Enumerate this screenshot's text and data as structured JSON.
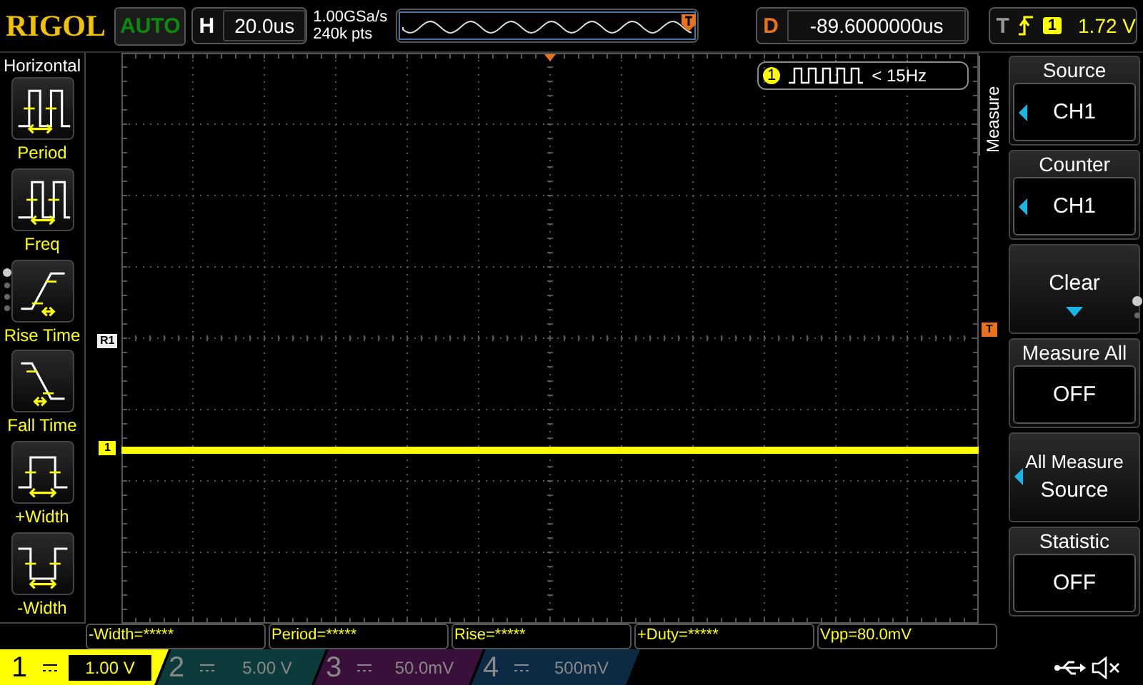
{
  "header": {
    "logo": "RIGOL",
    "run_status": "AUTO",
    "horizontal": {
      "label": "H",
      "value": "20.0us"
    },
    "sample_rate": "1.00GSa/s",
    "memory_depth": "240k pts",
    "delay": {
      "label": "D",
      "value": "-89.6000000us"
    },
    "trigger": {
      "label": "T",
      "channel": "1",
      "level": "1.72 V"
    }
  },
  "left_menu": {
    "title": "Horizontal",
    "items": [
      {
        "kind": "period",
        "label": "Period"
      },
      {
        "kind": "freq",
        "label": "Freq"
      },
      {
        "kind": "rise",
        "label": "Rise Time"
      },
      {
        "kind": "fall",
        "label": "Fall Time"
      },
      {
        "kind": "pwidth",
        "label": "+Width"
      },
      {
        "kind": "nwidth",
        "label": "-Width"
      }
    ]
  },
  "display": {
    "reference_marker": "R1",
    "channel_marker": "1",
    "trigger_marker": "T",
    "counter": {
      "channel": "1",
      "reading": "< 15Hz"
    }
  },
  "right_menu": {
    "title": "Measure",
    "items": [
      {
        "kind": "option",
        "label": "Source",
        "value": "CH1"
      },
      {
        "kind": "option",
        "label": "Counter",
        "value": "CH1"
      },
      {
        "kind": "action",
        "label": "Clear"
      },
      {
        "kind": "toggle",
        "label": "Measure All",
        "value": "OFF"
      },
      {
        "kind": "submenu",
        "label": "All Measure",
        "value": "Source"
      },
      {
        "kind": "toggle",
        "label": "Statistic",
        "value": "OFF"
      }
    ]
  },
  "measurements": [
    "-Width=*****",
    "Period=*****",
    "Rise=*****",
    "+Duty=*****",
    "Vpp=80.0mV"
  ],
  "channels": [
    {
      "number": "1",
      "scale": "1.00 V",
      "selected": true,
      "color": "#ffff00"
    },
    {
      "number": "2",
      "scale": "5.00 V",
      "selected": false,
      "color": "#0d3b3b"
    },
    {
      "number": "3",
      "scale": "50.0mV",
      "selected": false,
      "color": "#3a0f3a"
    },
    {
      "number": "4",
      "scale": "500mV",
      "selected": false,
      "color": "#0d2a45"
    }
  ]
}
